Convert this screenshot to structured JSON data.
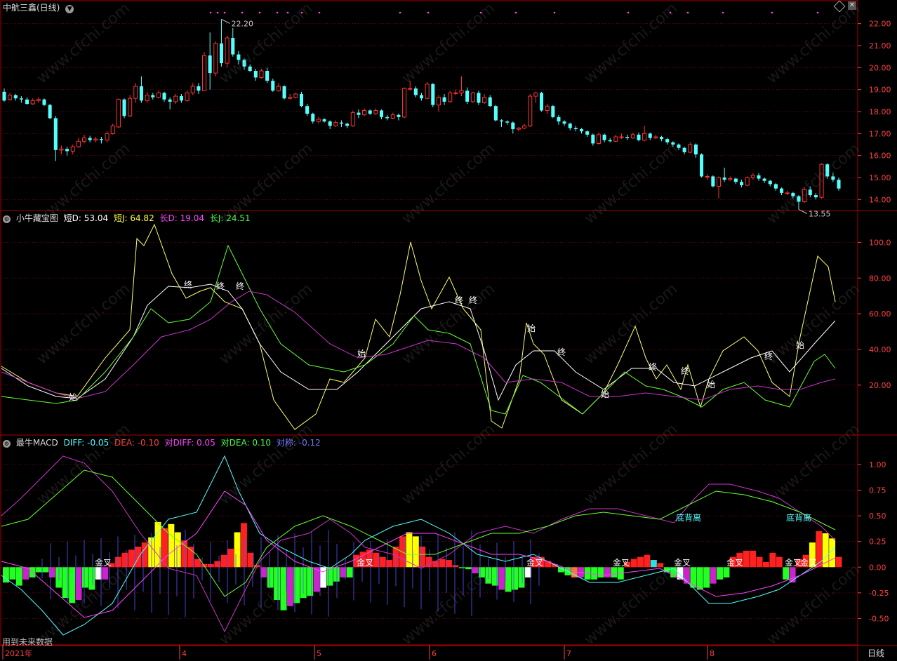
{
  "window": {
    "title": "中航三鑫(日线)",
    "period_label": "日线",
    "footer_note": "用到未来数据",
    "diamond_icon": "diamond-icon",
    "close_icon": "close-icon"
  },
  "colors": {
    "up": "#ff3333",
    "down": "#54ffff",
    "grid": "#7a0000",
    "border": "#aa0000",
    "axis_text": "#ff4040",
    "short_line": "#ffff66",
    "long_line": "#cc33cc",
    "mid_line": "#ffffff",
    "green_line": "#66ff33"
  },
  "price_panel": {
    "high_label": "22.20",
    "low_label": "13.55",
    "yticks": [
      "22.00",
      "21.00",
      "20.00",
      "19.00",
      "18.00",
      "17.00",
      "16.00",
      "15.00",
      "14.00"
    ]
  },
  "kdj_panel": {
    "title": "小牛藏宝图",
    "items": [
      {
        "label": "短D: 53.04",
        "color": "#ffffff"
      },
      {
        "label": "短J: 64.82",
        "color": "#ffff33"
      },
      {
        "label": "长D: 19.04",
        "color": "#ff44ff"
      },
      {
        "label": "长J: 24.51",
        "color": "#44ff44"
      }
    ],
    "yticks": [
      "100.0",
      "80.00",
      "60.00",
      "40.00",
      "20.00"
    ],
    "mark_start": "始",
    "mark_end": "终"
  },
  "macd_panel": {
    "title": "最牛MACD",
    "items": [
      {
        "label": "DIFF: -0.05",
        "color": "#55ffff"
      },
      {
        "label": "DEA: -0.10",
        "color": "#ff4040"
      },
      {
        "label": "对DIFF: 0.05",
        "color": "#ff44ff"
      },
      {
        "label": "对DEA: 0.10",
        "color": "#44ff44"
      },
      {
        "label": "对称: -0.12",
        "color": "#5555ff"
      }
    ],
    "yticks": [
      "1.00",
      "0.75",
      "0.50",
      "0.25",
      "0.00",
      "-0.25",
      "-0.50"
    ],
    "golden_cross": "金叉",
    "bottom_divergence": "底背离"
  },
  "x_axis": {
    "labels": [
      "2021年",
      "4",
      "5",
      "6",
      "7",
      "8"
    ]
  },
  "chart_data": {
    "type": "candlestick",
    "title": "中航三鑫(日线)",
    "ylim": [
      13.5,
      22.5
    ],
    "candles": [
      [
        18.9,
        18.5,
        19.05,
        18.45
      ],
      [
        18.55,
        18.75,
        18.85,
        18.5
      ],
      [
        18.75,
        18.6,
        18.8,
        18.5
      ],
      [
        18.6,
        18.55,
        18.7,
        18.4
      ],
      [
        18.55,
        18.35,
        18.65,
        18.3
      ],
      [
        18.35,
        18.5,
        18.6,
        18.3
      ],
      [
        18.5,
        18.55,
        18.65,
        18.4
      ],
      [
        18.55,
        18.3,
        18.6,
        18.25
      ],
      [
        18.3,
        17.7,
        18.35,
        17.65
      ],
      [
        17.7,
        16.25,
        17.8,
        15.75
      ],
      [
        16.25,
        16.3,
        16.45,
        16.05
      ],
      [
        16.3,
        16.2,
        16.4,
        16.0
      ],
      [
        16.2,
        16.4,
        16.5,
        16.05
      ],
      [
        16.4,
        16.65,
        16.8,
        16.35
      ],
      [
        16.65,
        16.8,
        16.95,
        16.55
      ],
      [
        16.8,
        16.7,
        16.9,
        16.6
      ],
      [
        16.7,
        16.75,
        16.85,
        16.6
      ],
      [
        16.75,
        16.7,
        16.85,
        16.55
      ],
      [
        16.7,
        17.0,
        17.1,
        16.6
      ],
      [
        17.0,
        17.35,
        17.45,
        16.95
      ],
      [
        17.3,
        18.55,
        18.6,
        17.25
      ],
      [
        18.55,
        17.8,
        18.6,
        17.7
      ],
      [
        17.8,
        18.6,
        18.75,
        17.75
      ],
      [
        18.6,
        19.15,
        19.3,
        18.4
      ],
      [
        19.15,
        18.5,
        19.6,
        18.4
      ],
      [
        18.5,
        18.75,
        18.9,
        18.4
      ],
      [
        18.75,
        18.65,
        18.85,
        18.55
      ],
      [
        18.65,
        18.85,
        18.95,
        18.6
      ],
      [
        18.85,
        18.55,
        18.9,
        18.45
      ],
      [
        18.55,
        18.45,
        18.65,
        18.1
      ],
      [
        18.45,
        18.7,
        18.8,
        18.35
      ],
      [
        18.7,
        18.5,
        18.8,
        18.4
      ],
      [
        18.5,
        18.85,
        18.95,
        18.45
      ],
      [
        18.85,
        19.15,
        19.3,
        18.75
      ],
      [
        19.15,
        18.95,
        19.3,
        18.8
      ],
      [
        18.95,
        20.55,
        20.7,
        18.95
      ],
      [
        20.55,
        19.75,
        21.6,
        19.0
      ],
      [
        19.75,
        21.1,
        21.2,
        19.6
      ],
      [
        21.1,
        20.2,
        22.2,
        20.05
      ],
      [
        20.2,
        21.35,
        21.45,
        20.0
      ],
      [
        21.35,
        20.6,
        21.8,
        20.5
      ],
      [
        20.6,
        20.35,
        20.75,
        20.15
      ],
      [
        20.35,
        20.05,
        20.4,
        19.9
      ],
      [
        20.05,
        19.85,
        20.15,
        19.8
      ],
      [
        19.85,
        19.55,
        19.95,
        19.4
      ],
      [
        19.55,
        19.85,
        19.95,
        19.5
      ],
      [
        19.85,
        19.4,
        20.0,
        19.3
      ],
      [
        19.4,
        18.95,
        19.5,
        18.9
      ],
      [
        18.95,
        19.15,
        19.3,
        18.9
      ],
      [
        19.15,
        18.6,
        19.2,
        18.55
      ],
      [
        18.6,
        18.65,
        18.8,
        18.55
      ],
      [
        18.65,
        18.8,
        18.85,
        18.6
      ],
      [
        18.8,
        18.25,
        18.9,
        18.2
      ],
      [
        18.25,
        17.9,
        18.35,
        17.8
      ],
      [
        17.9,
        17.55,
        17.95,
        17.45
      ],
      [
        17.55,
        17.65,
        17.75,
        17.45
      ],
      [
        17.65,
        17.55,
        17.7,
        17.5
      ],
      [
        17.55,
        17.35,
        17.6,
        17.2
      ],
      [
        17.35,
        17.5,
        17.6,
        17.3
      ],
      [
        17.5,
        17.45,
        17.6,
        17.3
      ],
      [
        17.45,
        17.35,
        17.5,
        17.25
      ],
      [
        17.35,
        17.95,
        18.05,
        17.3
      ],
      [
        17.95,
        17.85,
        18.1,
        17.7
      ],
      [
        17.85,
        18.05,
        18.15,
        17.8
      ],
      [
        18.05,
        17.9,
        18.1,
        17.85
      ],
      [
        17.9,
        18.05,
        18.15,
        17.85
      ],
      [
        18.05,
        17.75,
        18.1,
        17.65
      ],
      [
        17.75,
        17.7,
        17.85,
        17.6
      ],
      [
        17.7,
        17.85,
        17.95,
        17.65
      ],
      [
        17.85,
        17.75,
        17.9,
        17.6
      ],
      [
        17.75,
        19.05,
        19.1,
        17.7
      ],
      [
        19.05,
        19.05,
        19.4,
        18.95
      ],
      [
        19.05,
        18.75,
        19.15,
        18.65
      ],
      [
        18.75,
        18.6,
        18.85,
        18.5
      ],
      [
        18.6,
        19.25,
        19.35,
        18.55
      ],
      [
        19.25,
        18.3,
        19.3,
        18.2
      ],
      [
        18.3,
        18.65,
        18.75,
        18.0
      ],
      [
        18.65,
        18.45,
        18.8,
        18.3
      ],
      [
        18.45,
        18.85,
        18.95,
        18.4
      ],
      [
        18.85,
        18.85,
        19.0,
        18.75
      ],
      [
        18.85,
        18.95,
        19.6,
        18.7
      ],
      [
        18.95,
        18.45,
        19.1,
        18.35
      ],
      [
        18.45,
        18.85,
        18.9,
        18.4
      ],
      [
        18.85,
        18.4,
        18.95,
        18.3
      ],
      [
        18.4,
        18.65,
        18.8,
        18.35
      ],
      [
        18.65,
        18.25,
        18.75,
        18.2
      ],
      [
        18.25,
        17.6,
        18.3,
        17.55
      ],
      [
        17.6,
        17.55,
        17.65,
        17.3
      ],
      [
        17.55,
        17.5,
        17.6,
        17.4
      ],
      [
        17.5,
        17.2,
        17.55,
        17.0
      ],
      [
        17.2,
        17.25,
        17.3,
        17.1
      ],
      [
        17.25,
        17.35,
        17.45,
        17.2
      ],
      [
        17.35,
        18.7,
        18.8,
        17.3
      ],
      [
        18.7,
        18.85,
        18.9,
        18.4
      ],
      [
        18.85,
        18.05,
        18.9,
        18.0
      ],
      [
        18.05,
        18.25,
        18.35,
        17.9
      ],
      [
        18.25,
        17.75,
        18.3,
        17.7
      ],
      [
        17.75,
        17.55,
        17.85,
        17.4
      ],
      [
        17.55,
        17.45,
        17.6,
        17.35
      ],
      [
        17.45,
        17.25,
        17.5,
        17.15
      ],
      [
        17.25,
        17.2,
        17.35,
        17.1
      ],
      [
        17.2,
        17.1,
        17.25,
        17.0
      ],
      [
        17.1,
        16.95,
        17.15,
        16.85
      ],
      [
        16.95,
        16.55,
        17.0,
        16.45
      ],
      [
        16.55,
        16.95,
        17.05,
        16.5
      ],
      [
        16.95,
        16.7,
        17.0,
        16.6
      ],
      [
        16.7,
        16.65,
        16.8,
        16.6
      ],
      [
        16.65,
        16.85,
        16.95,
        16.6
      ],
      [
        16.85,
        16.85,
        17.0,
        16.75
      ],
      [
        16.85,
        16.8,
        16.95,
        16.7
      ],
      [
        16.8,
        16.95,
        17.05,
        16.75
      ],
      [
        16.95,
        16.7,
        17.05,
        16.65
      ],
      [
        16.7,
        17.0,
        17.35,
        16.65
      ],
      [
        17.0,
        16.8,
        17.05,
        16.7
      ],
      [
        16.8,
        16.85,
        16.95,
        16.75
      ],
      [
        16.85,
        16.75,
        16.9,
        16.65
      ],
      [
        16.75,
        16.6,
        16.8,
        16.5
      ],
      [
        16.6,
        16.5,
        16.65,
        16.4
      ],
      [
        16.5,
        16.35,
        16.55,
        16.25
      ],
      [
        16.35,
        16.15,
        16.4,
        16.05
      ],
      [
        16.15,
        16.5,
        16.6,
        16.1
      ],
      [
        16.5,
        16.05,
        16.55,
        15.9
      ],
      [
        16.05,
        15.05,
        16.1,
        15.0
      ],
      [
        15.05,
        15.05,
        15.15,
        14.9
      ],
      [
        15.05,
        14.6,
        15.1,
        14.55
      ],
      [
        14.6,
        15.0,
        15.05,
        14.05
      ],
      [
        15.0,
        14.9,
        15.45,
        14.8
      ],
      [
        14.9,
        14.95,
        15.05,
        14.85
      ],
      [
        14.95,
        14.8,
        15.0,
        14.7
      ],
      [
        14.8,
        14.65,
        14.9,
        14.55
      ],
      [
        14.65,
        15.0,
        15.05,
        14.6
      ],
      [
        15.0,
        15.1,
        15.2,
        14.9
      ],
      [
        15.1,
        14.95,
        15.2,
        14.85
      ],
      [
        14.95,
        14.85,
        15.0,
        14.75
      ],
      [
        14.85,
        14.7,
        14.9,
        14.6
      ],
      [
        14.7,
        14.5,
        14.75,
        14.4
      ],
      [
        14.5,
        14.3,
        14.55,
        14.2
      ],
      [
        14.3,
        14.3,
        14.4,
        14.2
      ],
      [
        14.3,
        14.15,
        14.35,
        14.05
      ],
      [
        14.15,
        13.9,
        14.2,
        13.55
      ],
      [
        13.9,
        14.45,
        14.55,
        13.85
      ],
      [
        14.45,
        14.2,
        14.6,
        14.1
      ],
      [
        14.2,
        14.1,
        14.3,
        14.0
      ],
      [
        14.1,
        15.6,
        15.65,
        14.05
      ],
      [
        15.6,
        15.05,
        15.65,
        14.95
      ],
      [
        15.05,
        14.9,
        15.2,
        14.8
      ],
      [
        14.9,
        14.5,
        15.0,
        14.4
      ]
    ]
  }
}
